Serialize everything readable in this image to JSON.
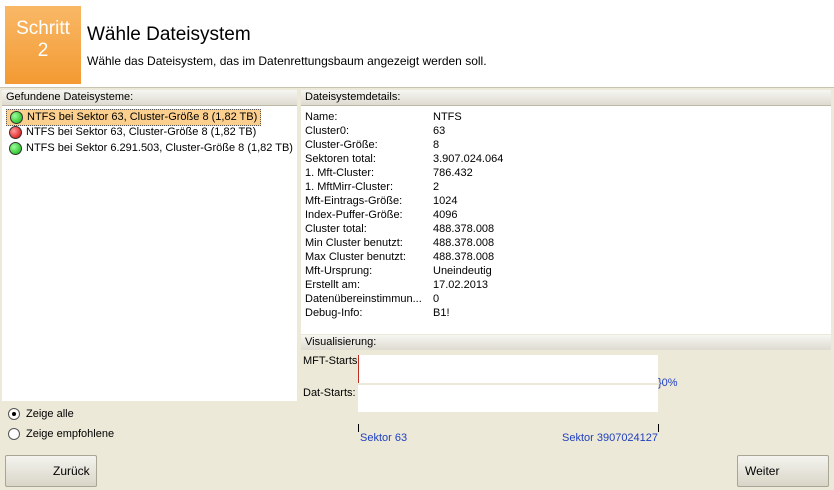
{
  "header": {
    "step_line1": "Schritt",
    "step_line2": "2",
    "title": "Wähle Dateisystem",
    "subtitle": "Wähle das Dateisystem, das im Datenrettungsbaum angezeigt werden soll."
  },
  "left_panel": {
    "title": "Gefundene Dateisysteme:",
    "items": [
      {
        "label": "NTFS bei Sektor 63, Cluster-Größe 8 (1,82 TB)",
        "status": "green",
        "selected": true
      },
      {
        "label": "NTFS bei Sektor 63, Cluster-Größe 8 (1,82 TB)",
        "status": "red",
        "selected": false
      },
      {
        "label": "NTFS bei Sektor 6.291.503, Cluster-Größe 8 (1,82 TB)",
        "status": "green",
        "selected": false
      }
    ],
    "radio_all": "Zeige alle",
    "radio_recommended": "Zeige empfohlene",
    "selected_radio": "all"
  },
  "details": {
    "title": "Dateisystemdetails:",
    "rows": [
      {
        "key": "Name:",
        "value": "NTFS"
      },
      {
        "key": "Cluster0:",
        "value": "63"
      },
      {
        "key": "Cluster-Größe:",
        "value": "8"
      },
      {
        "key": "Sektoren total:",
        "value": "3.907.024.064"
      },
      {
        "key": "1. Mft-Cluster:",
        "value": "786.432"
      },
      {
        "key": "1. MftMirr-Cluster:",
        "value": "2"
      },
      {
        "key": "Mft-Eintrags-Größe:",
        "value": "1024"
      },
      {
        "key": "Index-Puffer-Größe:",
        "value": "4096"
      },
      {
        "key": "Cluster total:",
        "value": "488.378.008"
      },
      {
        "key": "Min Cluster benutzt:",
        "value": "488.378.008"
      },
      {
        "key": "Max Cluster benutzt:",
        "value": "488.378.008"
      },
      {
        "key": "Mft-Ursprung:",
        "value": "Uneindeutig"
      },
      {
        "key": "Erstellt am:",
        "value": "17.02.2013"
      },
      {
        "key": "Datenübereinstimmun...",
        "value": "0"
      },
      {
        "key": "Debug-Info:",
        "value": "B1!"
      }
    ]
  },
  "visualization": {
    "title": "Visualisierung:",
    "mft_label": "MFT-Starts",
    "dat_label": "Dat-Starts:",
    "percent": "}0%",
    "start_sector": "Sektor 63",
    "end_sector": "Sektor 3907024127"
  },
  "buttons": {
    "back": "Zurück",
    "next": "Weiter"
  },
  "colors": {
    "step_orange": "#f39a33",
    "selected_bg": "#fbd08f",
    "arrow_yellow": "#f5d000",
    "link_blue": "#1f3fbf"
  }
}
